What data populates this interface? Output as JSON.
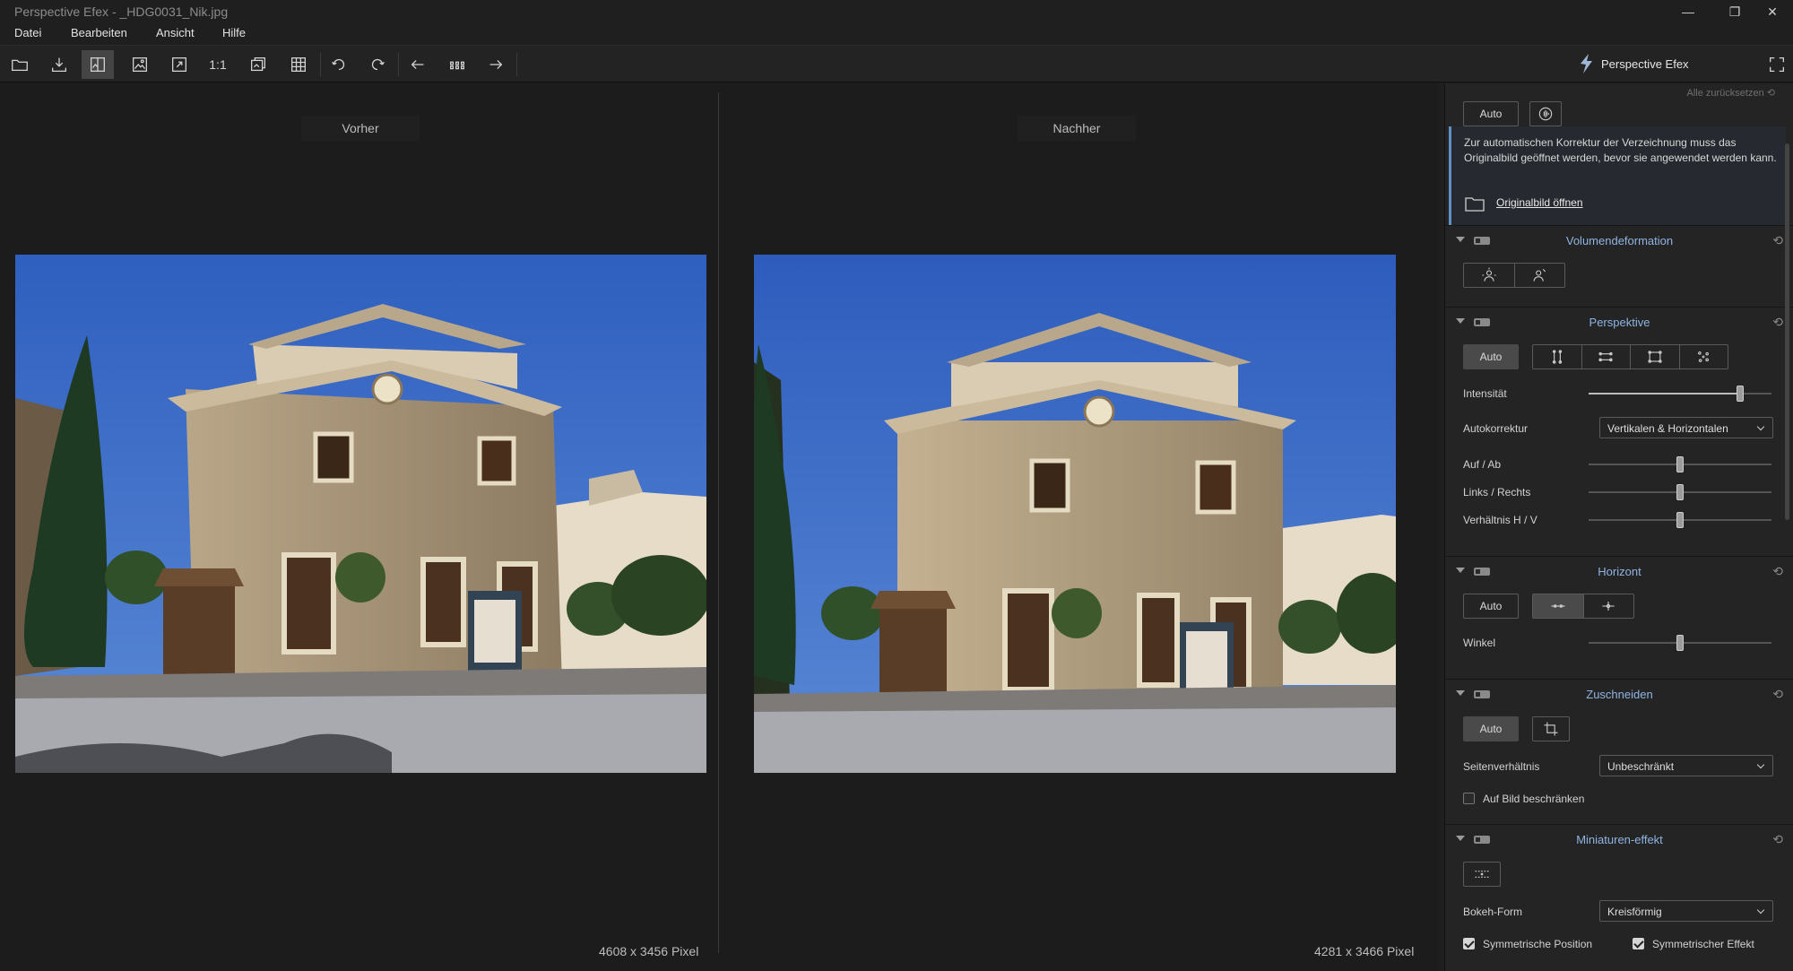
{
  "window": {
    "title": "Perspective Efex - _HDG0031_Nik.jpg",
    "controls": {
      "minimize": "—",
      "restore": "❐",
      "close": "✕"
    }
  },
  "menu": [
    "Datei",
    "Bearbeiten",
    "Ansicht",
    "Hilfe"
  ],
  "toolbar": {
    "actual_size_label": "1:1",
    "icons": [
      "open-folder-icon",
      "save-export-icon",
      "compare-view-icon",
      "single-view-icon",
      "fit-screen-icon",
      "one-to-one-icon",
      "overlay-icon",
      "grid-icon",
      "rotate-left-icon",
      "rotate-right-icon",
      "previous-icon",
      "filmstrip-icon",
      "next-icon"
    ],
    "brand": "Perspective Efex",
    "fullscreen_icon": "fullscreen-icon"
  },
  "viewer": {
    "before_label": "Vorher",
    "after_label": "Nachher",
    "before_dims": "4608 x 3456 Pixel",
    "after_dims": "4281 x 3466 Pixel"
  },
  "panel": {
    "reset_all": "Alle zurücksetzen",
    "distortion": {
      "auto_label": "Auto",
      "notice": "Zur automatischen Korrektur der Verzeichnung muss das Originalbild geöffnet werden, bevor sie angewendet werden kann.",
      "open_original": "Originalbild öffnen"
    },
    "volume": {
      "title": "Volumendeformation"
    },
    "perspective": {
      "title": "Perspektive",
      "auto_label": "Auto",
      "intensity_label": "Intensität",
      "intensity_value": 0.83,
      "autocorrect_label": "Autokorrektur",
      "autocorrect_value": "Vertikalen & Horizontalen",
      "updown_label": "Auf / Ab",
      "updown_value": 0.5,
      "leftright_label": "Links / Rechts",
      "leftright_value": 0.5,
      "ratio_label": "Verhältnis H / V",
      "ratio_value": 0.5
    },
    "horizon": {
      "title": "Horizont",
      "auto_label": "Auto",
      "angle_label": "Winkel",
      "angle_value": 0.5
    },
    "crop": {
      "title": "Zuschneiden",
      "auto_label": "Auto",
      "aspect_label": "Seitenverhältnis",
      "aspect_value": "Unbeschränkt",
      "restrict_label": "Auf Bild beschränken",
      "restrict_checked": false
    },
    "miniature": {
      "title": "Miniaturen-effekt",
      "bokeh_label": "Bokeh-Form",
      "bokeh_value": "Kreisförmig",
      "sym_position_label": "Symmetrische Position",
      "sym_position_checked": true,
      "sym_effect_label": "Symmetrischer Effekt",
      "sym_effect_checked": true
    }
  }
}
